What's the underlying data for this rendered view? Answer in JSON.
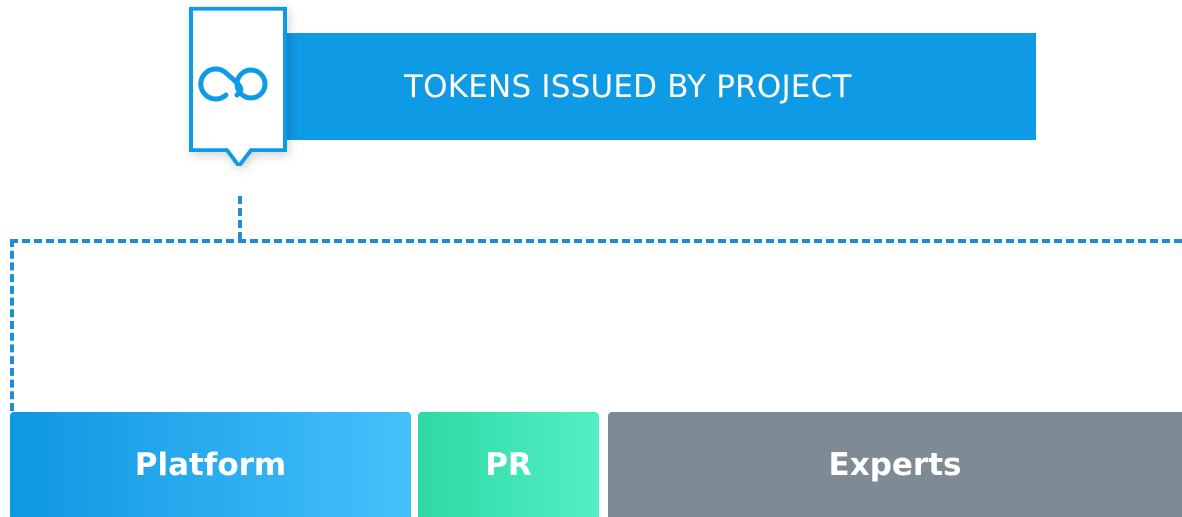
{
  "banner": {
    "title": "TOKENS ISSUED BY PROJECT",
    "color": "#0f9ae6"
  },
  "logo": {
    "icon": "infinity-co-logo-icon",
    "color": "#0f9ae6"
  },
  "connector_color": "#1d8fd4",
  "categories": [
    {
      "label": "Platform",
      "color": "#0f97e2"
    },
    {
      "label": "PR",
      "color": "#2ed9a5"
    },
    {
      "label": "Experts",
      "color": "#7e8a94"
    }
  ]
}
